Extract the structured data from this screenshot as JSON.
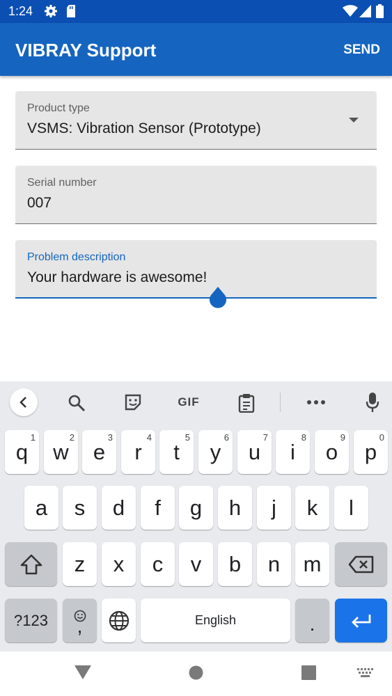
{
  "status_bar": {
    "time": "1:24",
    "icons": [
      "gear-icon",
      "sd-card-icon",
      "wifi-icon",
      "signal-icon",
      "battery-icon"
    ]
  },
  "app_bar": {
    "title": "VIBRAY Support",
    "action": "SEND",
    "color": "#1565c0"
  },
  "form": {
    "product_type": {
      "label": "Product type",
      "value": "VSMS: Vibration Sensor (Prototype)"
    },
    "serial_number": {
      "label": "Serial number",
      "value": "007"
    },
    "problem_description": {
      "label": "Problem description",
      "value": "Your hardware is awesome!"
    }
  },
  "keyboard": {
    "toolbar_icons": [
      "back-chevron-icon",
      "search-icon",
      "sticker-icon",
      "gif-icon",
      "clipboard-icon",
      "more-icon",
      "mic-icon"
    ],
    "gif_label": "GIF",
    "row1": [
      {
        "k": "q",
        "h": "1"
      },
      {
        "k": "w",
        "h": "2"
      },
      {
        "k": "e",
        "h": "3"
      },
      {
        "k": "r",
        "h": "4"
      },
      {
        "k": "t",
        "h": "5"
      },
      {
        "k": "y",
        "h": "6"
      },
      {
        "k": "u",
        "h": "7"
      },
      {
        "k": "i",
        "h": "8"
      },
      {
        "k": "o",
        "h": "9"
      },
      {
        "k": "p",
        "h": "0"
      }
    ],
    "row2": [
      "a",
      "s",
      "d",
      "f",
      "g",
      "h",
      "j",
      "k",
      "l"
    ],
    "row3": [
      "z",
      "x",
      "c",
      "v",
      "b",
      "n",
      "m"
    ],
    "symbols_label": "?123",
    "emoji_comma": ",",
    "space_label": "English",
    "period": ".",
    "accent_color": "#1a73e8"
  },
  "nav_bar": {
    "icons": [
      "back-triangle-icon",
      "home-circle-icon",
      "recents-square-icon",
      "keyboard-switch-icon"
    ]
  }
}
